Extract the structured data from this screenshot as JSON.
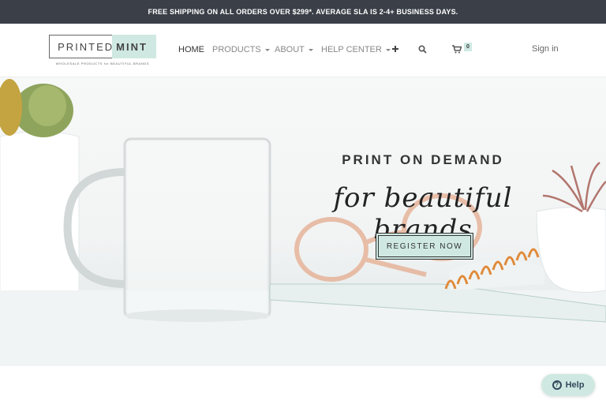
{
  "announcement": "FREE SHIPPING ON ALL ORDERS OVER $299*. AVERAGE SLA IS 2-4+ BUSINESS DAYS.",
  "logo": {
    "word1": "PRINTED",
    "word2": "MINT",
    "tagline": "WHOLESALE PRODUCTS for BEAUTIFUL BRANDS"
  },
  "nav": {
    "home": "HOME",
    "products": "PRODUCTS",
    "about": "ABOUT",
    "help_center": "HELP CENTER",
    "plus_icon": "plus-icon",
    "search_icon": "search-icon",
    "cart_icon": "cart-icon",
    "cart_count": "0",
    "sign_in": "Sign in"
  },
  "hero": {
    "title": "PRINT ON DEMAND",
    "script": "for beautiful brands",
    "cta": "REGISTER NOW"
  },
  "help_widget": {
    "label": "Help",
    "icon": "question-icon"
  },
  "colors": {
    "mint": "#cfe9e2",
    "topbar": "#3a3f48",
    "text_dark": "#333333"
  }
}
